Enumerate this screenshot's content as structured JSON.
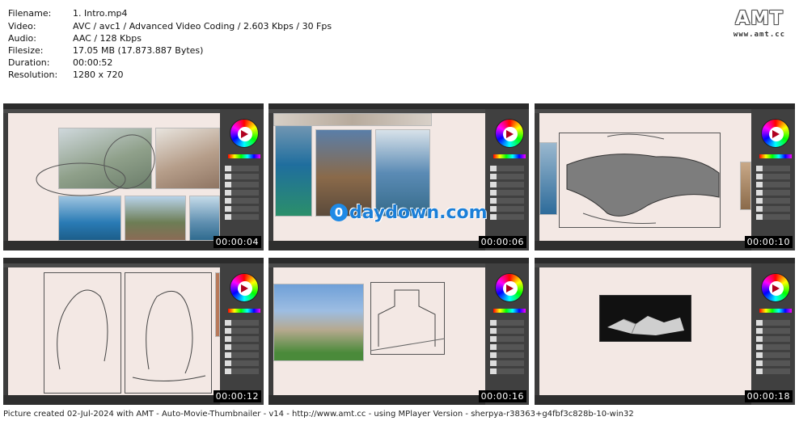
{
  "info": [
    {
      "label": "Filename:",
      "value": "1. Intro.mp4"
    },
    {
      "label": "Video:",
      "value": "AVC / avc1 / Advanced Video Coding / 2.603 Kbps / 30 Fps"
    },
    {
      "label": "Audio:",
      "value": "AAC / 128 Kbps"
    },
    {
      "label": "Filesize:",
      "value": "17.05 MB (17.873.887 Bytes)"
    },
    {
      "label": "Duration:",
      "value": "00:00:52"
    },
    {
      "label": "Resolution:",
      "value": "1280 x 720"
    }
  ],
  "logo": {
    "big": "AMT",
    "small": "www.amt.cc"
  },
  "thumbnails": [
    {
      "timestamp": "00:00:04"
    },
    {
      "timestamp": "00:00:06"
    },
    {
      "timestamp": "00:00:10"
    },
    {
      "timestamp": "00:00:12"
    },
    {
      "timestamp": "00:00:16"
    },
    {
      "timestamp": "00:00:18"
    }
  ],
  "watermark": {
    "icon": "0",
    "text": "daydown.com"
  },
  "footer": "Picture created 02-Jul-2024 with AMT - Auto-Movie-Thumbnailer - v14 - http://www.amt.cc - using MPlayer Version - sherpya-r38363+g4fbf3c828b-10-win32"
}
